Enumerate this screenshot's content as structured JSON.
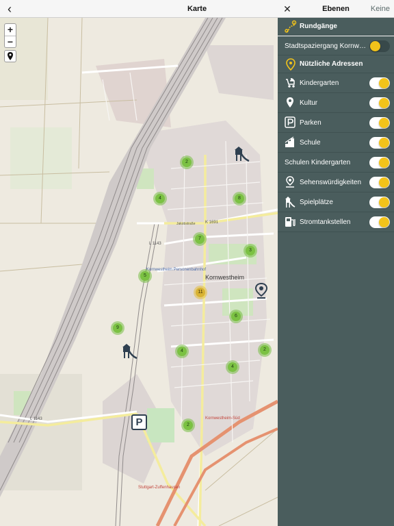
{
  "topbar": {
    "back_icon": "chevron-left-icon",
    "title": "Karte"
  },
  "map": {
    "zoom_in": "+",
    "zoom_out": "−",
    "locate_icon": "location-pin-icon",
    "labels": {
      "place_name": "Kornwestheim",
      "street_k1691": "K 1691",
      "street_l1143": "L 1143",
      "street_l1143_lower": "L 1143",
      "station": "Kornwestheim Personenbahnhof",
      "station_south": "Kornwestheim-Süd",
      "station_zuffenhausen": "Stuttgart-Zuffenhausen",
      "street_jakobstrasse": "Jakobstraße"
    },
    "clusters": [
      {
        "count": "2"
      },
      {
        "count": "4"
      },
      {
        "count": "8"
      },
      {
        "count": "7"
      },
      {
        "count": "3"
      },
      {
        "count": "5"
      },
      {
        "count": "11",
        "color": "yellow"
      },
      {
        "count": "6"
      },
      {
        "count": "9"
      },
      {
        "count": "4"
      },
      {
        "count": "2"
      },
      {
        "count": "4"
      },
      {
        "count": "2"
      }
    ],
    "parking_letter": "P",
    "playground_icon": "playground-icon",
    "poi_icon": "sightseeing-pin-icon"
  },
  "panel": {
    "close_icon": "close-icon",
    "title": "Ebenen",
    "none_label": "Keine",
    "tours_section": {
      "label": "Rundgänge",
      "icon": "route-icon"
    },
    "tours": [
      {
        "label": "Stadtspaziergang Kornw…",
        "enabled": false
      }
    ],
    "addresses_section": {
      "label": "Nützliche Adressen",
      "icon": "map-pin-icon"
    },
    "addresses": [
      {
        "label": "Kindergarten",
        "icon": "stroller-icon",
        "enabled": true
      },
      {
        "label": "Kultur",
        "icon": "location-icon",
        "enabled": true
      },
      {
        "label": "Parken",
        "icon": "parking-icon",
        "enabled": true
      },
      {
        "label": "Schule",
        "icon": "school-icon",
        "enabled": true
      },
      {
        "label": "Schulen Kindergarten",
        "icon": "",
        "enabled": true
      },
      {
        "label": "Sehenswürdigkeiten",
        "icon": "sights-icon",
        "enabled": true
      },
      {
        "label": "Spielplätze",
        "icon": "playground-icon",
        "enabled": true
      },
      {
        "label": "Stromtankstellen",
        "icon": "ev-charger-icon",
        "enabled": true
      }
    ],
    "accent": "#f2c31a",
    "panel_bg": "#4a5d5d"
  }
}
